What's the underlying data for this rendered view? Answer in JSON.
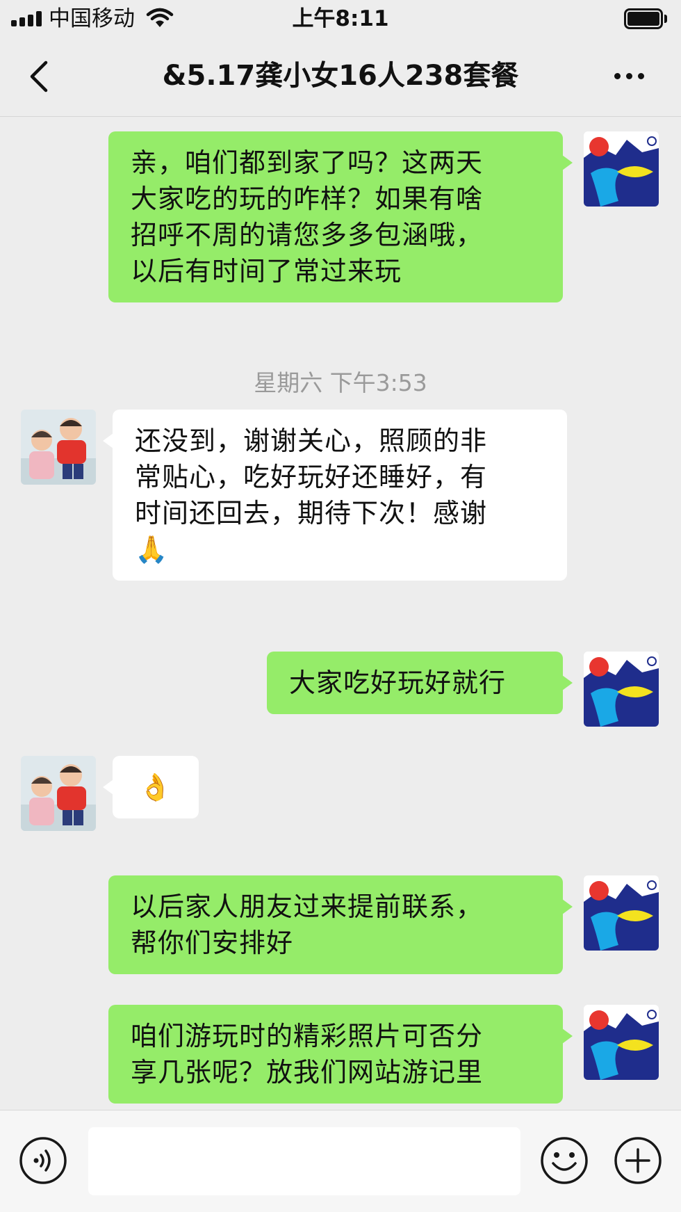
{
  "status_bar": {
    "carrier": "中国移动",
    "time": "上午8:11",
    "signal_icon": "signal-bars-icon",
    "wifi_icon": "wifi-icon",
    "battery_icon": "battery-icon",
    "battery_level": 1.0
  },
  "nav": {
    "title": "&5.17龚小女16人238套餐",
    "back_icon": "chevron-left-icon",
    "more_icon": "more-dots-icon"
  },
  "messages": [
    {
      "direction": "out",
      "lines": [
        "亲，咱们都到家了吗？这两天",
        "大家吃的玩的咋样？如果有啥",
        "招呼不周的请您多多包涵哦，",
        "以后有时间了常过来玩"
      ]
    },
    {
      "timestamp": "星期六 下午3:53"
    },
    {
      "direction": "in",
      "lines": [
        "还没到，谢谢关心，照顾的非",
        "常贴心，吃好玩好还睡好，有",
        "时间还回去，期待下次！感谢",
        "🙏"
      ]
    },
    {
      "direction": "out",
      "lines": [
        "大家吃好玩好就行"
      ]
    },
    {
      "direction": "in",
      "lines": [
        "👌"
      ]
    },
    {
      "direction": "out",
      "lines": [
        "以后家人朋友过来提前联系，",
        "帮你们安排好"
      ]
    },
    {
      "direction": "out",
      "lines": [
        "咱们游玩时的精彩照片可否分",
        "享几张呢？放我们网站游记里"
      ]
    }
  ],
  "input_bar": {
    "voice_icon": "voice-icon",
    "placeholder": "",
    "emoji_icon": "smiley-icon",
    "plus_icon": "plus-circle-icon"
  },
  "colors": {
    "background": "#ededed",
    "outgoing_bubble": "#95ec69",
    "incoming_bubble": "#ffffff",
    "timestamp_text": "#9a9a9a"
  }
}
